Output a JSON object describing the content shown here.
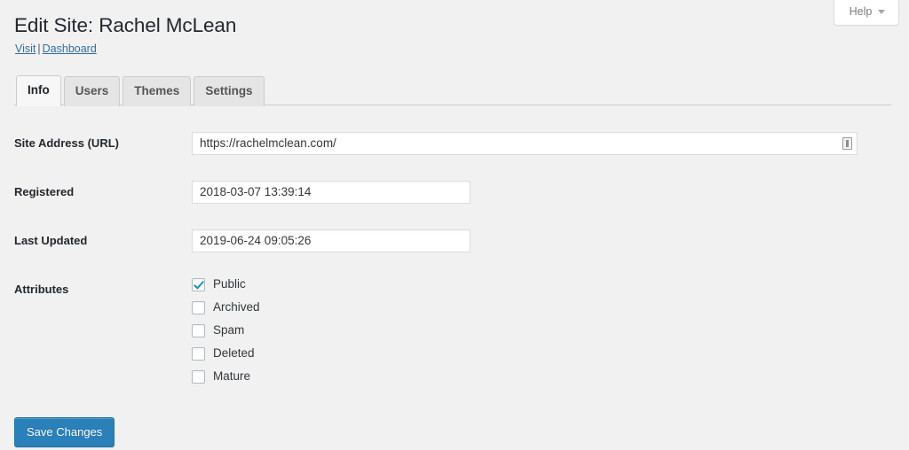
{
  "help": {
    "label": "Help",
    "caret_icon": "chevron-down-icon"
  },
  "header": {
    "title": "Edit Site: Rachel McLean",
    "links": [
      {
        "label": "Visit"
      },
      {
        "label": "Dashboard"
      }
    ],
    "link_separator": "|"
  },
  "tabs": [
    {
      "label": "Info",
      "active": true
    },
    {
      "label": "Users",
      "active": false
    },
    {
      "label": "Themes",
      "active": false
    },
    {
      "label": "Settings",
      "active": false
    }
  ],
  "form": {
    "site_address": {
      "label": "Site Address (URL)",
      "value": "https://rachelmclean.com/",
      "placeholder": "",
      "autofill_icon": "autofill-icon"
    },
    "registered": {
      "label": "Registered",
      "value": "2018-03-07 13:39:14",
      "placeholder": ""
    },
    "last_updated": {
      "label": "Last Updated",
      "value": "2019-06-24 09:05:26",
      "placeholder": ""
    },
    "attributes": {
      "label": "Attributes",
      "options": [
        {
          "label": "Public",
          "checked": true
        },
        {
          "label": "Archived",
          "checked": false
        },
        {
          "label": "Spam",
          "checked": false
        },
        {
          "label": "Deleted",
          "checked": false
        },
        {
          "label": "Mature",
          "checked": false
        }
      ]
    }
  },
  "submit": {
    "save_label": "Save Changes"
  },
  "colors": {
    "page_background": "#f1f1f1",
    "primary_button": "#2a80b9",
    "link": "#2b70a8",
    "checkmark": "#1e8cbe",
    "active_tab_background": "#f7f7f7"
  }
}
